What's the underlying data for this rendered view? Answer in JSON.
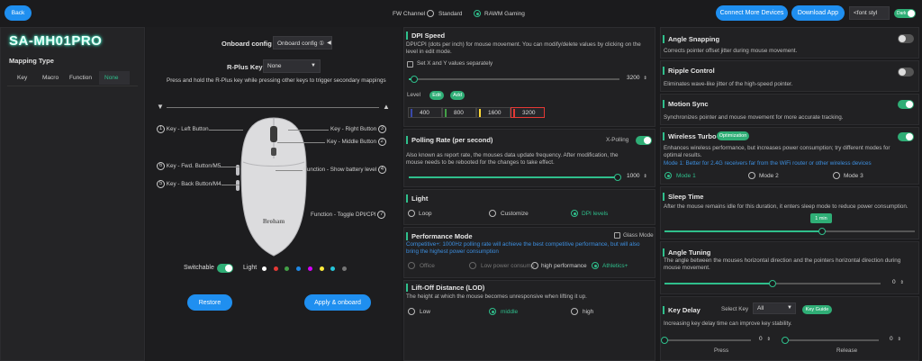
{
  "header": {
    "back_label": "Back",
    "fw_channel_label": "FW Channel",
    "fw_options": [
      "Standard",
      "RAWM Gaming"
    ],
    "fw_selected": "RAWM Gaming",
    "connect_more_label": "Connect More Devices",
    "download_app_label": "Download App",
    "font_select_value": "<font styl",
    "theme_toggle_label": "Dark"
  },
  "sidebar": {
    "device_name": "SA-MH01PRO",
    "mapping_type_label": "Mapping Type",
    "mapping_tabs": [
      "Key",
      "Macro",
      "Function",
      "None"
    ],
    "mapping_selected": "None"
  },
  "center": {
    "onboard_config_label": "Onboard config",
    "onboard_config_value": "Onboard config ①",
    "rplus_key_label": "R-Plus Key",
    "rplus_key_value": "None",
    "rplus_hint": "Press and hold the R-Plus key while pressing other keys to trigger secondary mappings",
    "mouse_brand": "Broham",
    "callouts_left": [
      {
        "num": "1",
        "text": "Key - Left Button"
      },
      {
        "num": "6",
        "text": "Key - Fwd. Button/M5"
      },
      {
        "num": "5",
        "text": "Key - Back Button/M4"
      }
    ],
    "callouts_right": [
      {
        "num": "3",
        "text": "Key - Right Button"
      },
      {
        "num": "2",
        "text": "Key - Middle Button"
      },
      {
        "num": "4",
        "text": "Function - Show battery level"
      },
      {
        "num": "7",
        "text": "Function - Toggle DPI/CPI"
      }
    ],
    "switchable_label": "Switchable",
    "light_label": "Light",
    "light_colors": [
      "#ffffff",
      "#e53935",
      "#43a047",
      "#1e88e5",
      "#d500f9",
      "#ffeb3b",
      "#26c6da",
      "#757575"
    ],
    "restore_label": "Restore",
    "apply_label": "Apply & onboard"
  },
  "dpi": {
    "title": "DPI Speed",
    "desc": "DPI/CPI (dots per inch) for mouse movement. You can modify/delete values by clicking on the level in edit mode.",
    "set_xy_label": "Set X and Y values separately",
    "value": "3200",
    "slider_fraction": 0.02,
    "level_label": "Level",
    "edit_label": "Edit",
    "add_label": "Add",
    "levels": [
      {
        "value": "400",
        "color": "#3949ab"
      },
      {
        "value": "800",
        "color": "#43a047"
      },
      {
        "value": "1600",
        "color": "#fdd835"
      },
      {
        "value": "3200",
        "color": "#e53935"
      }
    ]
  },
  "polling": {
    "title": "Polling Rate (per second)",
    "xpolling_label": "X-Polling",
    "desc": "Also known as report rate, the mouses data update frequency. After modification, the mouse needs to be rebooted for the changes to take effect.",
    "value": "1000"
  },
  "light": {
    "title": "Light",
    "options": [
      "Loop",
      "Customize",
      "DPI levels"
    ],
    "selected": "DPI levels"
  },
  "performance": {
    "title": "Performance Mode",
    "glass_mode_label": "Glass Mode",
    "desc": "Competitive+: 1000Hz polling rate will achieve the best competitive performance, but will also bring the highest power consumption",
    "options": [
      "Office",
      "Low power consump…",
      "high performance",
      "Athletics+"
    ],
    "selected": "Athletics+"
  },
  "lod": {
    "title": "Lift-Off Distance (LOD)",
    "desc": "The height at which the mouse becomes unresponsive when lifting it up.",
    "options": [
      "Low",
      "middle",
      "high"
    ],
    "selected": "middle"
  },
  "angle_snapping": {
    "title": "Angle Snapping",
    "desc": "Corrects pointer offset jitter during mouse movement."
  },
  "ripple": {
    "title": "Ripple Control",
    "desc": "Eliminates wave-like jitter of the high-speed pointer."
  },
  "motion_sync": {
    "title": "Motion Sync",
    "desc": "Synchronizes pointer and mouse movement for more accurate tracking."
  },
  "wireless_turbo": {
    "title": "Wireless Turbo",
    "optimization_label": "Optimization",
    "desc": "Enhances wireless performance, but increases power consumption; try different modes for optimal results.",
    "mode_note": "Mode 1: Better for 2.4G receivers far from the WiFi router or other wireless devices",
    "modes": [
      "Mode 1",
      "Mode 2",
      "Mode 3"
    ],
    "selected": "Mode 1"
  },
  "sleep": {
    "title": "Sleep Time",
    "desc": "After the mouse remains idle for this duration, it enters sleep mode to reduce power consumption.",
    "value": "1 min",
    "slider_fraction": 0.5
  },
  "angle_tuning": {
    "title": "Angle Tuning",
    "desc": "The angle between the mouses horizontal direction and the pointers horizontal direction during mouse movement.",
    "value": "0"
  },
  "key_delay": {
    "title": "Key Delay",
    "select_key_label": "Select Key",
    "select_key_value": "All",
    "key_guide_label": "Key Guide",
    "desc": "Increasing key delay time can improve key stability.",
    "press_value": "0",
    "release_value": "0",
    "press_label": "Press",
    "release_label": "Release"
  }
}
